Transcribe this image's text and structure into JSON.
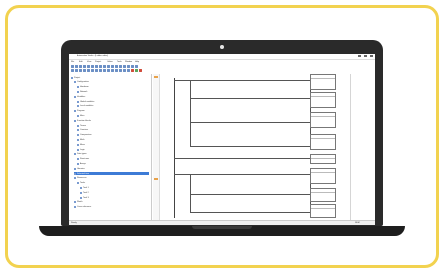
{
  "app": {
    "title": "Automation Studio - [Ladder editor]",
    "menu": [
      "File",
      "Edit",
      "View",
      "Project",
      "Online",
      "Tools",
      "Window",
      "Help"
    ],
    "status_left": "Ready",
    "status_right": "NUM"
  },
  "sidebar": {
    "items": [
      {
        "label": "Project",
        "indent": 0
      },
      {
        "label": "Configuration",
        "indent": 1
      },
      {
        "label": "Hardware",
        "indent": 2
      },
      {
        "label": "Network",
        "indent": 2
      },
      {
        "label": "Variables",
        "indent": 1
      },
      {
        "label": "Global variables",
        "indent": 2
      },
      {
        "label": "Local variables",
        "indent": 2
      },
      {
        "label": "Program",
        "indent": 1
      },
      {
        "label": "Main",
        "indent": 2
      },
      {
        "label": "Function blocks",
        "indent": 1
      },
      {
        "label": "Timers",
        "indent": 2
      },
      {
        "label": "Counters",
        "indent": 2
      },
      {
        "label": "Comparators",
        "indent": 2
      },
      {
        "label": "Math",
        "indent": 2
      },
      {
        "label": "Move",
        "indent": 2
      },
      {
        "label": "Logic",
        "indent": 2
      },
      {
        "label": "Data types",
        "indent": 1
      },
      {
        "label": "Structures",
        "indent": 2
      },
      {
        "label": "Arrays",
        "indent": 2
      },
      {
        "label": "Libraries",
        "indent": 1
      },
      {
        "label": "Selected item",
        "indent": 1,
        "selected": true
      },
      {
        "label": "Resources",
        "indent": 1
      },
      {
        "label": "Tasks",
        "indent": 2
      },
      {
        "label": "Task 1",
        "indent": 3
      },
      {
        "label": "Task 2",
        "indent": 3
      },
      {
        "label": "Task 3",
        "indent": 3
      },
      {
        "label": "Watch",
        "indent": 1
      },
      {
        "label": "Cross reference",
        "indent": 1
      }
    ]
  },
  "colors": {
    "frame": "#f2d24f",
    "laptop": "#2a2a2a",
    "selection": "#3d7bd6"
  }
}
